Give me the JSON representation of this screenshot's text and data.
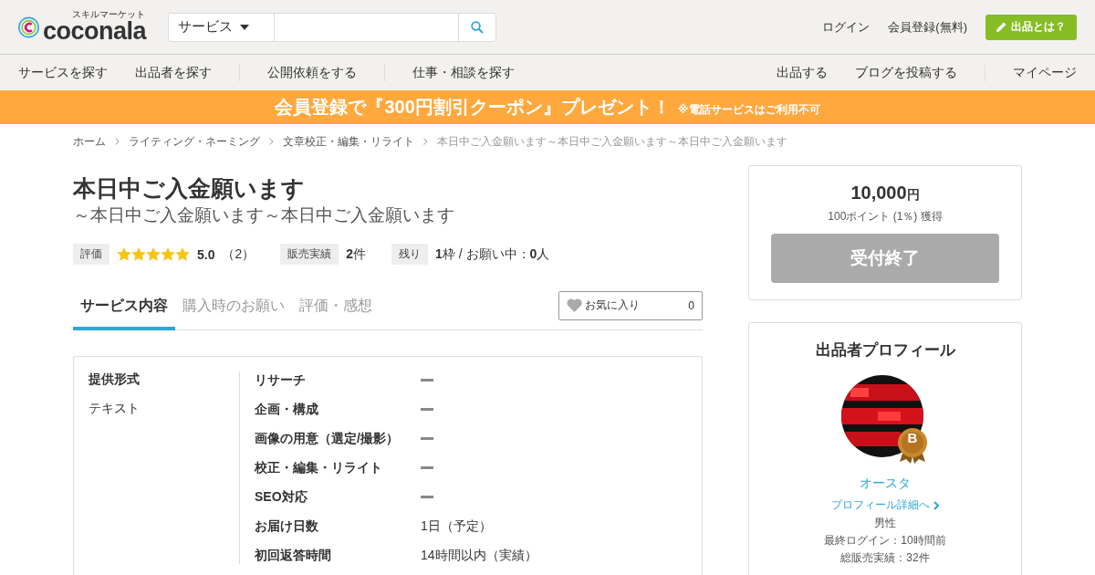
{
  "header": {
    "logo": {
      "tagline": "スキルマーケット",
      "name": "coconala"
    },
    "search": {
      "category": "サービス"
    },
    "links": [
      "ログイン",
      "会員登録(無料)"
    ],
    "cta": "出品とは？"
  },
  "nav": {
    "left_groups": [
      [
        "サービスを探す",
        "出品者を探す"
      ],
      [
        "公開依頼をする"
      ],
      [
        "仕事・相談を探す"
      ]
    ],
    "right_groups": [
      [
        "出品する",
        "ブログを投稿する"
      ],
      [
        "マイページ"
      ]
    ]
  },
  "banner": {
    "main": "会員登録で『300円割引クーポン』プレゼント！",
    "note": "※電話サービスはご利用不可"
  },
  "breadcrumb": [
    "ホーム",
    "ライティング・ネーミング",
    "文章校正・編集・リライト",
    "本日中ご入金願います～本日中ご入金願います～本日中ご入金願います"
  ],
  "title": "本日中ご入金願います",
  "subtitle": "～本日中ご入金願います～本日中ご入金願います",
  "rating": {
    "label": "評価",
    "stars": 5,
    "score": "5.0",
    "count": "（2）"
  },
  "sales": {
    "label": "販売実績",
    "value": "**2**件"
  },
  "remaining": {
    "label": "残り",
    "value": "**1**枠 / お願い中：**0**人"
  },
  "tabs": [
    {
      "label": "サービス内容",
      "selected": true
    },
    {
      "label": "購入時のお願い",
      "selected": false
    },
    {
      "label": "評価・感想",
      "selected": false
    }
  ],
  "favorite": {
    "label": "お気に入り",
    "count": "0"
  },
  "spec": {
    "heading": "提供形式",
    "value": "テキスト",
    "rows": [
      {
        "label": "リサーチ",
        "kind": "dash"
      },
      {
        "label": "企画・構成",
        "kind": "dash"
      },
      {
        "label": "画像の用意（選定/撮影）",
        "kind": "dash"
      },
      {
        "label": "校正・編集・リライト",
        "kind": "dash"
      },
      {
        "label": "SEO対応",
        "kind": "dash"
      },
      {
        "label": "お届け日数",
        "kind": "text",
        "value": "1日（予定）"
      },
      {
        "label": "初回返答時間",
        "kind": "text",
        "value": "14時間以内（実績）"
      }
    ]
  },
  "price": {
    "amount": "10,000",
    "unit": "円",
    "points": "100ポイント (1％) 獲得",
    "button": {
      "label": "受付終了",
      "disabled": true
    }
  },
  "profile": {
    "heading": "出品者プロフィール",
    "badge": "B",
    "name": "オースタ",
    "link": "プロフィール詳細へ",
    "details": [
      "男性",
      "最終ログイン：10時間前",
      "総販売実績：32件"
    ]
  }
}
